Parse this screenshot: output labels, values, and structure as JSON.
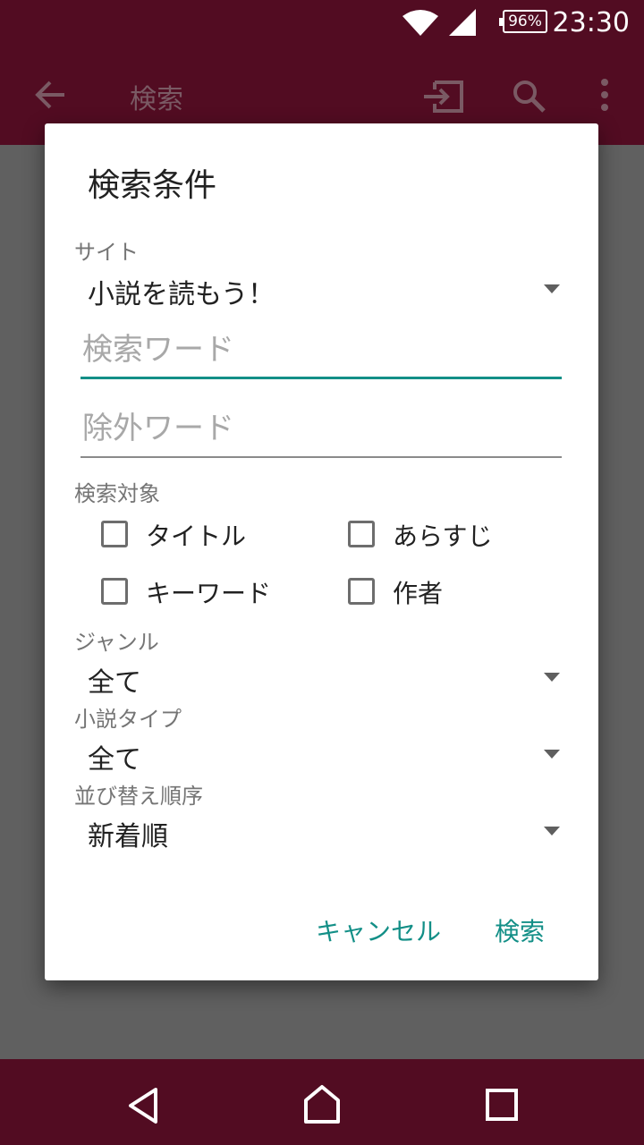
{
  "status_bar": {
    "battery_percent": "96%",
    "time": "23:30"
  },
  "app_bar": {
    "title": "検索",
    "icons": [
      "back-arrow-icon",
      "open-in-icon",
      "search-icon",
      "more-vert-icon"
    ]
  },
  "dialog": {
    "title": "検索条件",
    "site": {
      "label": "サイト",
      "value": "小説を読もう！"
    },
    "search_word": {
      "placeholder": "検索ワード",
      "value": ""
    },
    "exclude_word": {
      "placeholder": "除外ワード",
      "value": ""
    },
    "targets": {
      "label": "検索対象",
      "options": [
        {
          "label": "タイトル",
          "checked": false
        },
        {
          "label": "あらすじ",
          "checked": false
        },
        {
          "label": "キーワード",
          "checked": false
        },
        {
          "label": "作者",
          "checked": false
        }
      ]
    },
    "genre": {
      "label": "ジャンル",
      "value": "全て"
    },
    "novel_type": {
      "label": "小説タイプ",
      "value": "全て"
    },
    "sort_order": {
      "label": "並び替え順序",
      "value": "新着順"
    },
    "cancel_label": "キャンセル",
    "search_label": "検索"
  },
  "colors": {
    "primary_dark": "#520c22",
    "accent": "#138f87",
    "scrim": "#606060"
  }
}
